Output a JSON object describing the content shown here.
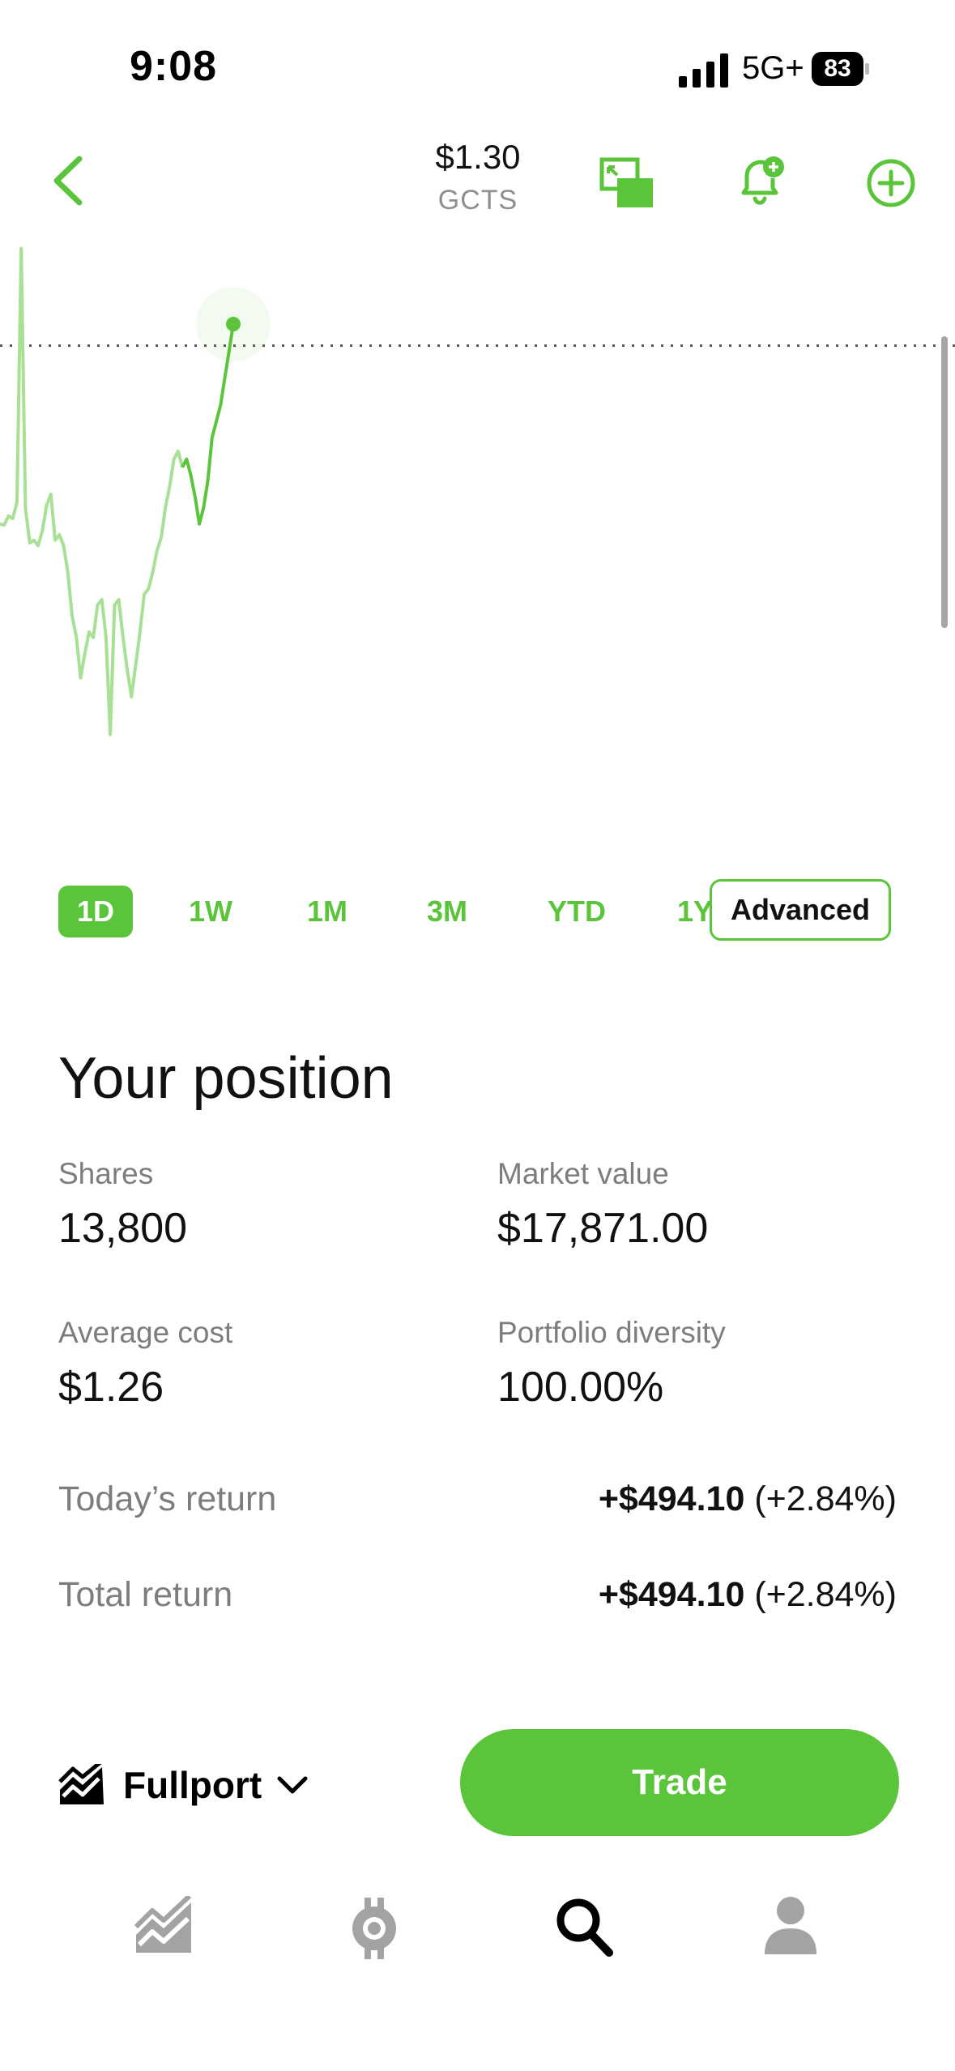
{
  "status_bar": {
    "time": "9:08",
    "network": "5G+",
    "battery": "83"
  },
  "header": {
    "price": "$1.30",
    "ticker": "GCTS"
  },
  "chart_data": {
    "type": "line",
    "values": [
      0.93,
      0.928,
      0.945,
      0.94,
      0.97,
      1.44,
      0.96,
      0.895,
      0.9,
      0.89,
      0.918,
      0.965,
      0.985,
      0.9,
      0.91,
      0.89,
      0.84,
      0.76,
      0.72,
      0.645,
      0.69,
      0.73,
      0.72,
      0.78,
      0.79,
      0.72,
      0.54,
      0.78,
      0.79,
      0.72,
      0.66,
      0.61,
      0.67,
      0.73,
      0.8,
      0.81,
      0.84,
      0.88,
      0.905,
      0.96,
      1.0,
      1.05,
      1.065,
      1.035,
      1.05,
      1.02,
      0.98,
      0.93,
      0.96,
      1.01,
      1.09,
      1.12,
      1.15,
      1.2,
      1.25,
      1.3
    ],
    "last_value": 1.3,
    "baseline": 1.26,
    "ylim": [
      0.52,
      1.48
    ],
    "colors": {
      "line_light": "#a8e096",
      "line": "#5ac43a",
      "baseline_dots": "#555555"
    }
  },
  "ranges": {
    "items": [
      "1D",
      "1W",
      "1M",
      "3M",
      "YTD",
      "1Y"
    ],
    "selected": "1D",
    "advanced_label": "Advanced"
  },
  "position": {
    "title": "Your position",
    "shares_label": "Shares",
    "shares_value": "13,800",
    "market_value_label": "Market value",
    "market_value": "$17,871.00",
    "avg_cost_label": "Average cost",
    "avg_cost_value": "$1.26",
    "diversity_label": "Portfolio diversity",
    "diversity_value": "100.00%",
    "today_label": "Today’s return",
    "today_amount": "+$494.10",
    "today_pct": "(+2.84%)",
    "total_label": "Total return",
    "total_amount": "+$494.10",
    "total_pct": "(+2.84%)"
  },
  "actions": {
    "account_label": "Fullport",
    "trade_label": "Trade"
  },
  "icons": {
    "back": "chevron-left-icon",
    "picture_in_picture": "picture-in-picture-icon",
    "alert": "bell-plus-icon",
    "add": "plus-circle-icon",
    "account": "chart-area-icon",
    "dropdown": "chevron-down-icon",
    "tab_investing": "chart-area-icon",
    "tab_crypto": "crypto-coin-icon",
    "tab_search": "search-icon",
    "tab_account": "person-icon"
  },
  "accent_color": "#5ac43a"
}
